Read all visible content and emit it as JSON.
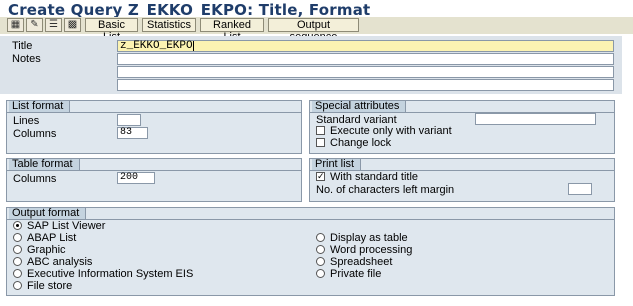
{
  "window": {
    "title": "Create Query Z_EKKO_EKPO: Title, Format"
  },
  "toolbar": {
    "icons": [
      "display-icon",
      "change-icon",
      "list-icon",
      "table-icon"
    ],
    "basic_list": "Basic List",
    "statistics": "Statistics",
    "ranked_list": "Ranked List",
    "output_sequence": "Output sequence"
  },
  "header": {
    "title_label": "Title",
    "title_value": "z_EKKO_EKPO",
    "notes_label": "Notes",
    "notes_lines": [
      "",
      "",
      ""
    ]
  },
  "list_format": {
    "heading": "List format",
    "lines_label": "Lines",
    "lines_value": "",
    "columns_label": "Columns",
    "columns_value": "83"
  },
  "special_attributes": {
    "heading": "Special attributes",
    "standard_variant_label": "Standard variant",
    "standard_variant_value": "",
    "execute_only_label": "Execute only with variant",
    "execute_only_checked": false,
    "change_lock_label": "Change lock",
    "change_lock_checked": false
  },
  "table_format": {
    "heading": "Table format",
    "columns_label": "Columns",
    "columns_value": "200"
  },
  "print_list": {
    "heading": "Print list",
    "with_standard_title_label": "With standard title",
    "with_standard_title_checked": true,
    "margin_label": "No. of characters left margin",
    "margin_value": ""
  },
  "output_format": {
    "heading": "Output format",
    "selected": "SAP List Viewer",
    "left_options": [
      "SAP List Viewer",
      "ABAP List",
      "Graphic",
      "ABC analysis",
      "Executive Information System EIS",
      "File store"
    ],
    "right_options": [
      "Display as table",
      "Word processing",
      "Spreadsheet",
      "Private file"
    ]
  }
}
